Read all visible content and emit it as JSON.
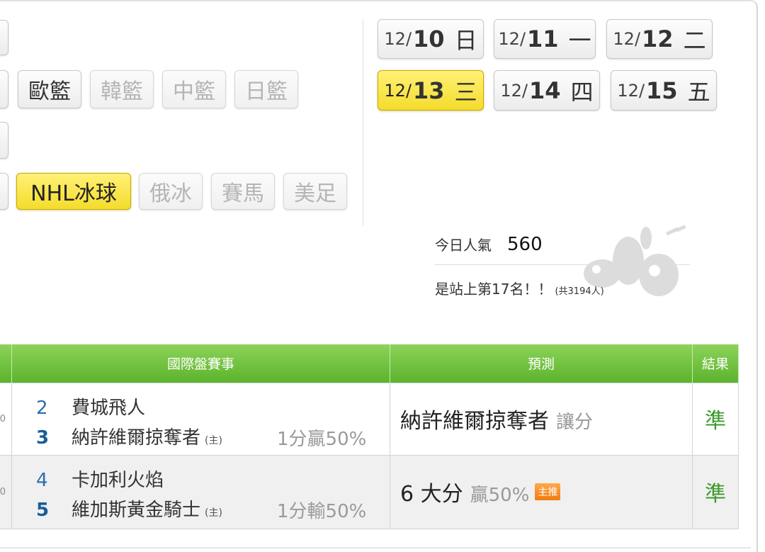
{
  "leagues": {
    "row2": [
      {
        "label": "歐籃",
        "state": "normal"
      },
      {
        "label": "韓籃",
        "state": "disabled"
      },
      {
        "label": "中籃",
        "state": "disabled"
      },
      {
        "label": "日籃",
        "state": "disabled"
      }
    ],
    "row4": [
      {
        "label": "NHL冰球",
        "state": "active"
      },
      {
        "label": "俄冰",
        "state": "disabled"
      },
      {
        "label": "賽馬",
        "state": "disabled"
      },
      {
        "label": "美足",
        "state": "disabled"
      }
    ]
  },
  "dates": [
    {
      "month": "12/",
      "day": "10",
      "weekday": "日",
      "state": "normal"
    },
    {
      "month": "12/",
      "day": "11",
      "weekday": "一",
      "state": "normal"
    },
    {
      "month": "12/",
      "day": "12",
      "weekday": "二",
      "state": "normal"
    },
    {
      "month": "12/",
      "day": "13",
      "weekday": "三",
      "state": "active"
    },
    {
      "month": "12/",
      "day": "14",
      "weekday": "四",
      "state": "normal"
    },
    {
      "month": "12/",
      "day": "15",
      "weekday": "五",
      "state": "normal"
    }
  ],
  "popularity": {
    "label": "今日人氣",
    "count": "560",
    "rank_text": "是站上第17名！！",
    "total_text": "(共3194人)"
  },
  "table": {
    "headers": {
      "event": "國際盤賽事",
      "prediction": "預測",
      "result": "結果"
    },
    "rows": [
      {
        "cut": "0",
        "away_num": "2",
        "away_team": "費城飛人",
        "home_num": "3",
        "home_team": "納許維爾掠奪者",
        "home_tag": "(主)",
        "odds": "1分贏50%",
        "prediction_main": "納許維爾掠奪者",
        "prediction_sub": "讓分",
        "prediction_extra": "",
        "badge": "",
        "result": "準"
      },
      {
        "cut": "0",
        "away_num": "4",
        "away_team": "卡加利火焰",
        "home_num": "5",
        "home_team": "維加斯黃金騎士",
        "home_tag": "(主)",
        "odds": "1分輸50%",
        "prediction_main": "6 大分",
        "prediction_sub": "贏50%",
        "prediction_extra": "",
        "badge": "主推",
        "result": "準"
      }
    ]
  },
  "colors": {
    "accent_green": "#6cc13a",
    "active_yellow": "#f7e43a",
    "result_green": "#3c9a2a",
    "badge_orange": "#f28a1f"
  }
}
